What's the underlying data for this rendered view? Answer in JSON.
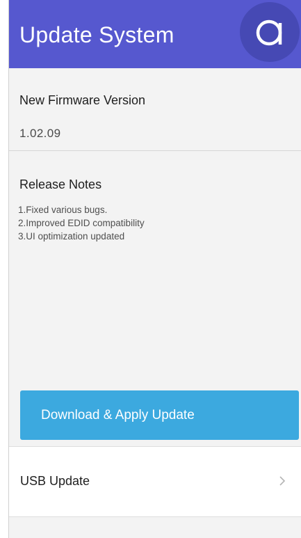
{
  "header": {
    "title": "Update System",
    "brand_icon": "letter-a-logo-icon",
    "background_color": "#5658cf"
  },
  "firmware": {
    "label": "New Firmware Version",
    "version": "1.02.09"
  },
  "release_notes": {
    "label": "Release Notes",
    "items": [
      "1.Fixed various bugs.",
      "2.Improved EDID compatibility",
      "3.UI optimization updated"
    ]
  },
  "actions": {
    "download_label": "Download & Apply Update",
    "download_color": "#3ca9df"
  },
  "usb_update": {
    "label": "USB Update",
    "icon": "chevron-right-icon"
  }
}
